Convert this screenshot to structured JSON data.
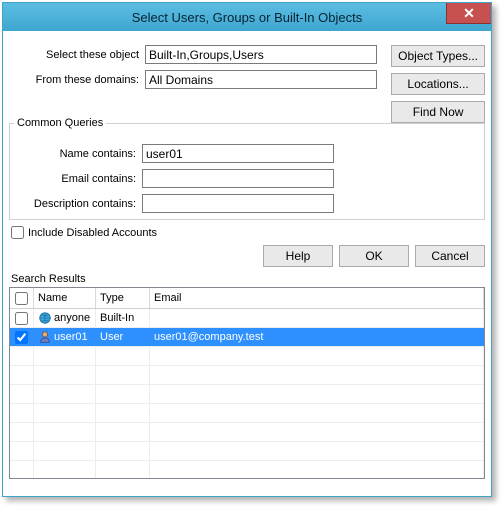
{
  "title": "Select Users, Groups or Built-In Objects",
  "close_glyph": "✕",
  "labels": {
    "object": "Select these object",
    "domain": "From these domains:",
    "common": "Common Queries",
    "name": "Name contains:",
    "email": "Email contains:",
    "desc": "Description contains:",
    "disabled": "Include Disabled Accounts",
    "results": "Search Results"
  },
  "fields": {
    "object": "Built-In,Groups,Users",
    "domain": "All Domains",
    "name": "user01",
    "email": "",
    "desc": ""
  },
  "buttons": {
    "types": "Object Types...",
    "locations": "Locations...",
    "findnow": "Find Now",
    "help": "Help",
    "ok": "OK",
    "cancel": "Cancel"
  },
  "grid": {
    "headers": {
      "name": "Name",
      "type": "Type",
      "email": "Email"
    },
    "rows": [
      {
        "checked": false,
        "icon": "globe-icon",
        "name": "anyone",
        "type": "Built-In",
        "email": "",
        "selected": false
      },
      {
        "checked": true,
        "icon": "user-icon",
        "name": "user01",
        "type": "User",
        "email": "user01@company.test",
        "selected": true
      }
    ]
  }
}
